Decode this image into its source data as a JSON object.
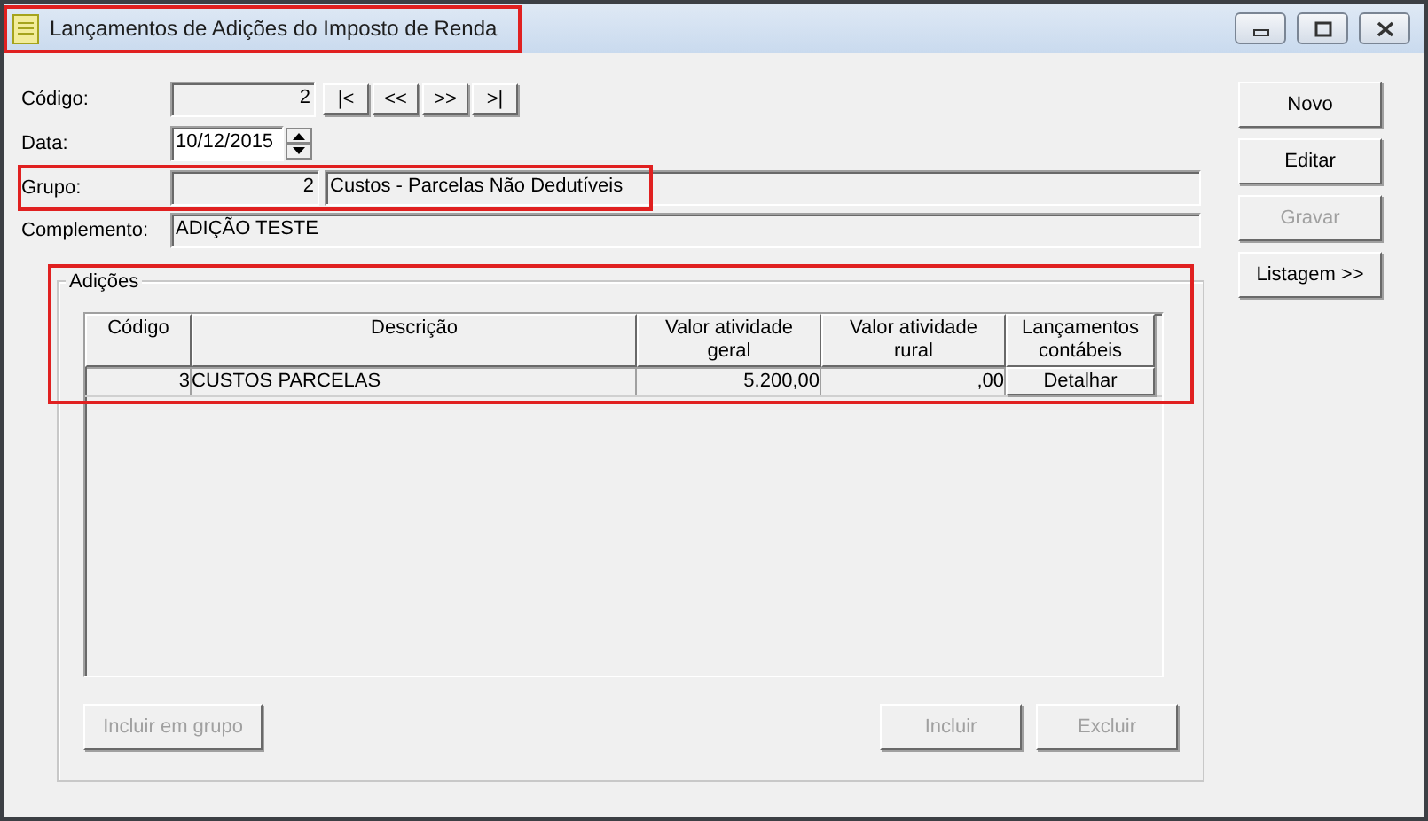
{
  "window": {
    "title": "Lançamentos de Adições do Imposto de Renda"
  },
  "codigo": {
    "label": "Código:",
    "value": "2"
  },
  "nav_buttons": [
    "|<",
    "<<",
    ">>",
    ">|"
  ],
  "data": {
    "label": "Data:",
    "value": "10/12/2015"
  },
  "grupo": {
    "label": "Grupo:",
    "code": "2",
    "description": "Custos - Parcelas Não Dedutíveis"
  },
  "complemento": {
    "label": "Complemento:",
    "value": "ADIÇÃO TESTE"
  },
  "side_buttons": [
    {
      "label": "Novo",
      "disabled": false
    },
    {
      "label": "Editar",
      "disabled": false
    },
    {
      "label": "Gravar",
      "disabled": true
    },
    {
      "label": "Listagem >>",
      "disabled": false
    }
  ],
  "adicoes": {
    "title": "Adições",
    "columns": [
      "Código",
      "Descrição",
      "Valor atividade geral",
      "Valor atividade rural",
      "Lançamentos contábeis"
    ],
    "rows": [
      {
        "codigo": "3",
        "descricao": "CUSTOS PARCELAS",
        "valor_geral": "5.200,00",
        "valor_rural": ",00",
        "action": "Detalhar"
      }
    ],
    "left_buttons": [
      {
        "label": "Incluir em grupo",
        "disabled": true
      }
    ],
    "right_buttons": [
      {
        "label": "Incluir",
        "disabled": true
      },
      {
        "label": "Excluir",
        "disabled": true
      }
    ]
  }
}
